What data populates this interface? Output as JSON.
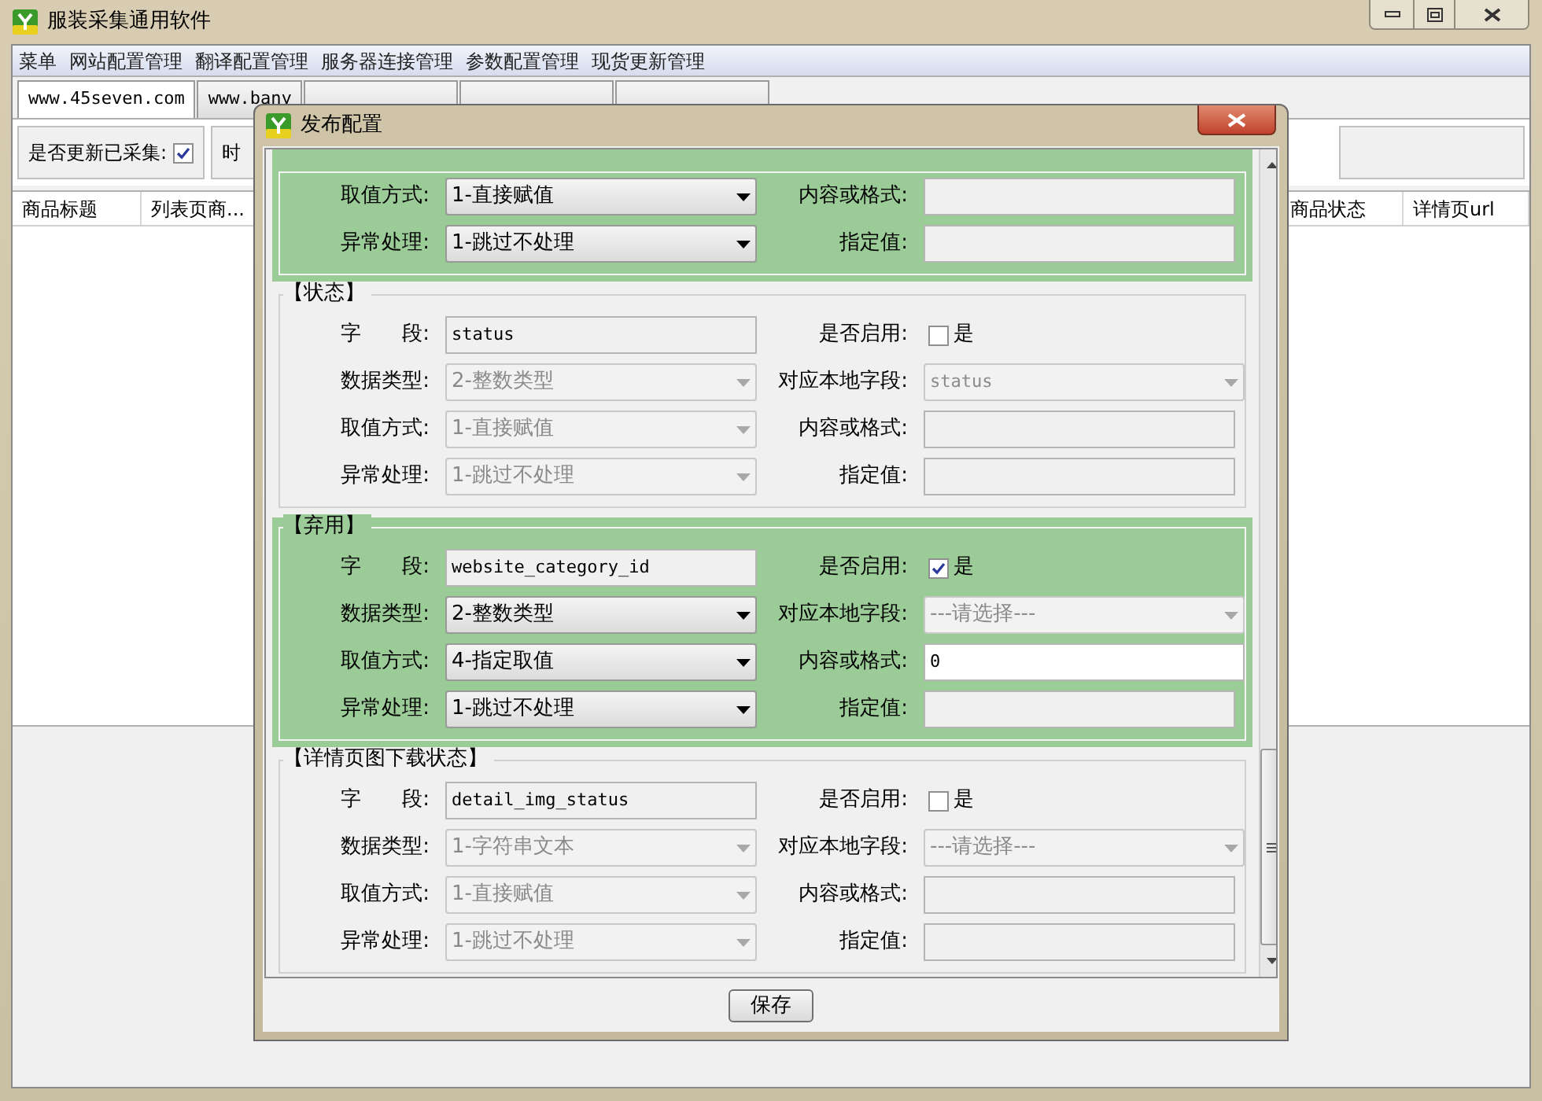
{
  "window": {
    "title": "服装采集通用软件"
  },
  "menu": [
    "菜单",
    "网站配置管理",
    "翻译配置管理",
    "服务器连接管理",
    "参数配置管理",
    "现货更新管理"
  ],
  "tabs": [
    {
      "label": "www.45seven.com",
      "selected": true
    },
    {
      "label": "www.bany",
      "selected": false
    },
    {
      "selected": false
    },
    {
      "selected": false
    },
    {
      "selected": false
    }
  ],
  "toolbar": {
    "update_label": "是否更新已采集:",
    "update_checked": true,
    "time_label": "时"
  },
  "table": {
    "columns": [
      "商品标题",
      "列表页商...",
      "商品状态",
      "详情页url"
    ]
  },
  "dialog": {
    "title": "发布配置",
    "save": "保存",
    "sections": [
      {
        "enabled": true,
        "rows": [
          {
            "left": {
              "label": "取值方式:",
              "kind": "select",
              "value": "1-直接赋值"
            },
            "right": {
              "label": "内容或格式:",
              "kind": "text"
            }
          },
          {
            "left": {
              "label": "异常处理:",
              "kind": "select",
              "value": "1-跳过不处理"
            },
            "right": {
              "label": "指定值:",
              "kind": "text"
            }
          }
        ]
      },
      {
        "title": "【状态】",
        "enabled": false,
        "rows": [
          {
            "left": {
              "label": "字　　段:",
              "kind": "text",
              "value": "status"
            },
            "right": {
              "label": "是否启用:",
              "kind": "checkbox",
              "value": "是",
              "checked": false
            }
          },
          {
            "left": {
              "label": "数据类型:",
              "kind": "select",
              "value": "2-整数类型"
            },
            "right": {
              "label": "对应本地字段:",
              "kind": "select",
              "value": "status",
              "mono": true
            }
          },
          {
            "left": {
              "label": "取值方式:",
              "kind": "select",
              "value": "1-直接赋值"
            },
            "right": {
              "label": "内容或格式:",
              "kind": "text"
            }
          },
          {
            "left": {
              "label": "异常处理:",
              "kind": "select",
              "value": "1-跳过不处理"
            },
            "right": {
              "label": "指定值:",
              "kind": "text"
            }
          }
        ]
      },
      {
        "title": "【弃用】",
        "enabled": true,
        "rows": [
          {
            "left": {
              "label": "字　　段:",
              "kind": "text",
              "value": "website_category_id"
            },
            "right": {
              "label": "是否启用:",
              "kind": "checkbox",
              "value": "是",
              "checked": true
            }
          },
          {
            "left": {
              "label": "数据类型:",
              "kind": "select",
              "value": "2-整数类型"
            },
            "right": {
              "label": "对应本地字段:",
              "kind": "select",
              "value": "---请选择---",
              "locked": true
            }
          },
          {
            "left": {
              "label": "取值方式:",
              "kind": "select",
              "value": "4-指定取值"
            },
            "right": {
              "label": "内容或格式:",
              "kind": "input",
              "value": "0"
            }
          },
          {
            "left": {
              "label": "异常处理:",
              "kind": "select",
              "value": "1-跳过不处理"
            },
            "right": {
              "label": "指定值:",
              "kind": "text"
            }
          }
        ]
      },
      {
        "title": "【详情页图下载状态】",
        "enabled": false,
        "rows": [
          {
            "left": {
              "label": "字　　段:",
              "kind": "text",
              "value": "detail_img_status"
            },
            "right": {
              "label": "是否启用:",
              "kind": "checkbox",
              "value": "是",
              "checked": false
            }
          },
          {
            "left": {
              "label": "数据类型:",
              "kind": "select",
              "value": "1-字符串文本"
            },
            "right": {
              "label": "对应本地字段:",
              "kind": "select",
              "value": "---请选择---"
            }
          },
          {
            "left": {
              "label": "取值方式:",
              "kind": "select",
              "value": "1-直接赋值"
            },
            "right": {
              "label": "内容或格式:",
              "kind": "text"
            }
          },
          {
            "left": {
              "label": "异常处理:",
              "kind": "select",
              "value": "1-跳过不处理"
            },
            "right": {
              "label": "指定值:",
              "kind": "text"
            }
          }
        ]
      }
    ]
  }
}
